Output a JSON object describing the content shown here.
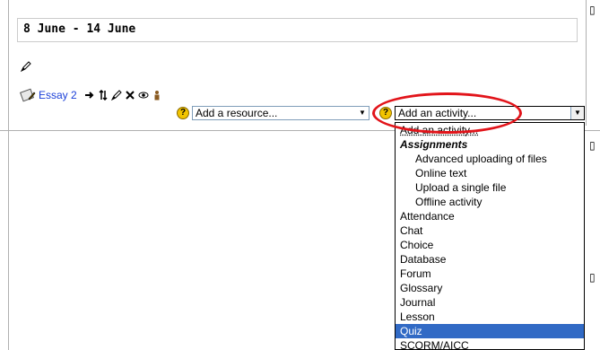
{
  "week": {
    "title": "8 June - 14 June"
  },
  "activity_row": {
    "name": "Essay 2"
  },
  "add_resource": {
    "selected": "Add a resource..."
  },
  "add_activity": {
    "selected": "Add an activity...",
    "options": [
      {
        "label": "Add an activity...",
        "kind": "first"
      },
      {
        "label": "Assignments",
        "kind": "group"
      },
      {
        "label": "Advanced uploading of files",
        "kind": "sub"
      },
      {
        "label": "Online text",
        "kind": "sub"
      },
      {
        "label": "Upload a single file",
        "kind": "sub"
      },
      {
        "label": "Offline activity",
        "kind": "sub"
      },
      {
        "label": "Attendance",
        "kind": "item"
      },
      {
        "label": "Chat",
        "kind": "item"
      },
      {
        "label": "Choice",
        "kind": "item"
      },
      {
        "label": "Database",
        "kind": "item"
      },
      {
        "label": "Forum",
        "kind": "item"
      },
      {
        "label": "Glossary",
        "kind": "item"
      },
      {
        "label": "Journal",
        "kind": "item"
      },
      {
        "label": "Lesson",
        "kind": "item"
      },
      {
        "label": "Quiz",
        "kind": "selected"
      },
      {
        "label": "SCORM/AICC",
        "kind": "item"
      }
    ]
  },
  "colors": {
    "link": "#1a3fd8",
    "highlight": "#316ac5",
    "annotation": "#e2141a",
    "help_icon": "#f2c400"
  }
}
